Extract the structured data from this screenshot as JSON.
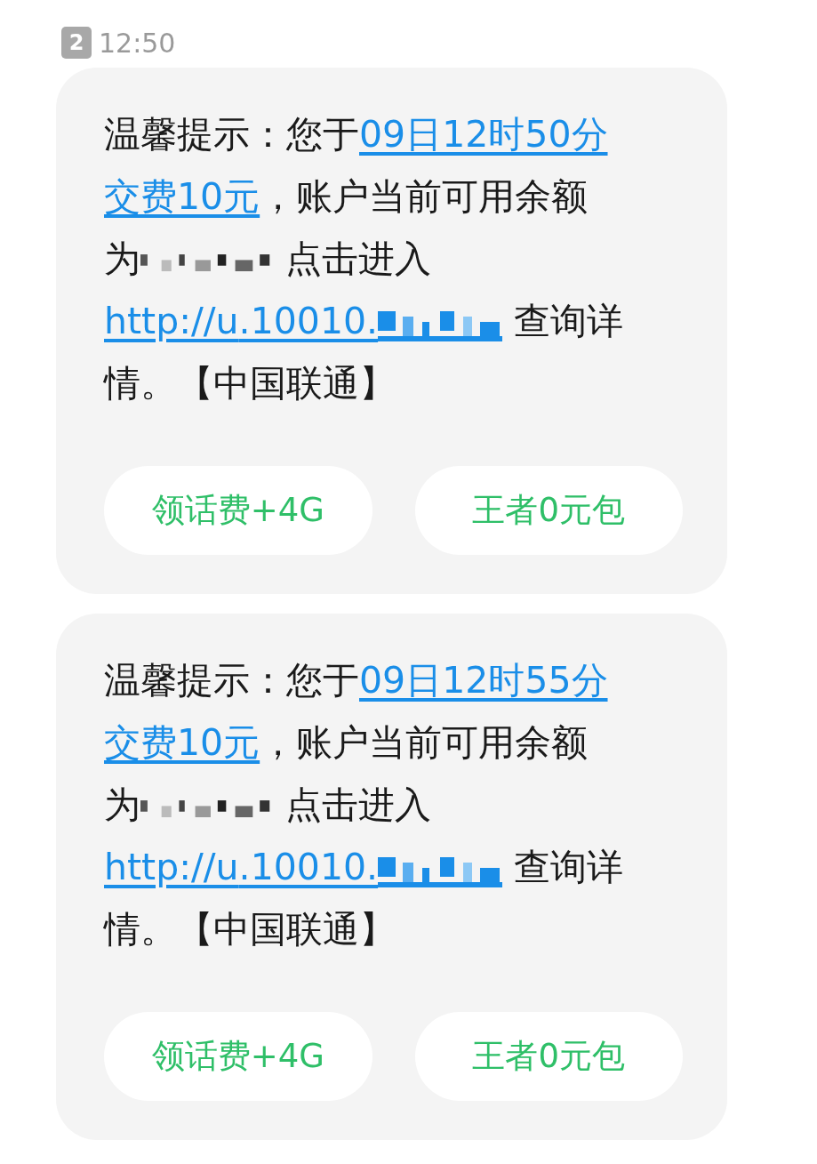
{
  "header": {
    "sim_badge": "2",
    "time": "12:50"
  },
  "messages": [
    {
      "segments": [
        {
          "kind": "text",
          "text": "温馨提示："
        },
        {
          "kind": "text",
          "text": "您于"
        },
        {
          "kind": "link",
          "text": "09日12时50分"
        },
        {
          "kind": "link",
          "text": "交费10元"
        },
        {
          "kind": "text",
          "text": "，账户当前可用余额"
        },
        {
          "kind": "redacted",
          "text": "为"
        },
        {
          "kind": "text",
          "text": " 点击进入 "
        },
        {
          "kind": "link",
          "text": "http://u"
        },
        {
          "kind": "link",
          "text": ".10010."
        },
        {
          "kind": "redacted_link"
        },
        {
          "kind": "text",
          "text": " 查询详情。【中国联通】"
        }
      ],
      "buttons": [
        "领话费+4G",
        "王者0元包"
      ]
    },
    {
      "segments": [
        {
          "kind": "text",
          "text": "温馨提示："
        },
        {
          "kind": "text",
          "text": "您于"
        },
        {
          "kind": "link",
          "text": "09日12时55分"
        },
        {
          "kind": "link",
          "text": "交费10元"
        },
        {
          "kind": "text",
          "text": "，账户当前可用余额"
        },
        {
          "kind": "redacted",
          "text": "为"
        },
        {
          "kind": "text",
          "text": " 点击进入 "
        },
        {
          "kind": "link",
          "text": "http://u"
        },
        {
          "kind": "link",
          "text": ".10010."
        },
        {
          "kind": "redacted_link"
        },
        {
          "kind": "text",
          "text": " 查询详情。【中国联通】"
        }
      ],
      "buttons": [
        "领话费+4G",
        "王者0元包"
      ]
    }
  ]
}
